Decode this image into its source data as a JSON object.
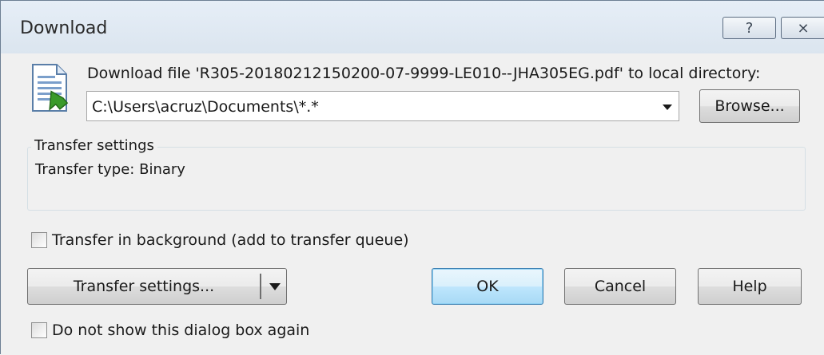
{
  "window": {
    "title": "Download",
    "help_glyph": "?",
    "close_glyph": "⨯"
  },
  "prompt": {
    "text": "Download file 'R305-20180212150200-07-9999-LE010--JHA305EG.pdf' to local directory:",
    "icon": "file-download-icon"
  },
  "directory": {
    "value": "C:\\Users\\acruz\\Documents\\*.*"
  },
  "browse_label": "Browse...",
  "transfer_group": {
    "legend": "Transfer settings",
    "text": "Transfer type: Binary"
  },
  "background_checkbox": {
    "label": "Transfer in background (add to transfer queue)",
    "checked": false
  },
  "transfer_settings_label": "Transfer settings...",
  "ok_label": "OK",
  "cancel_label": "Cancel",
  "help_label": "Help",
  "no_show_checkbox": {
    "label": "Do not show this dialog box again",
    "checked": false
  },
  "colors": {
    "title_bg": "#dfe8f1",
    "client_bg": "#f0f0f0",
    "default_button": "#bee6fd",
    "icon_green": "#3a9a2a"
  }
}
